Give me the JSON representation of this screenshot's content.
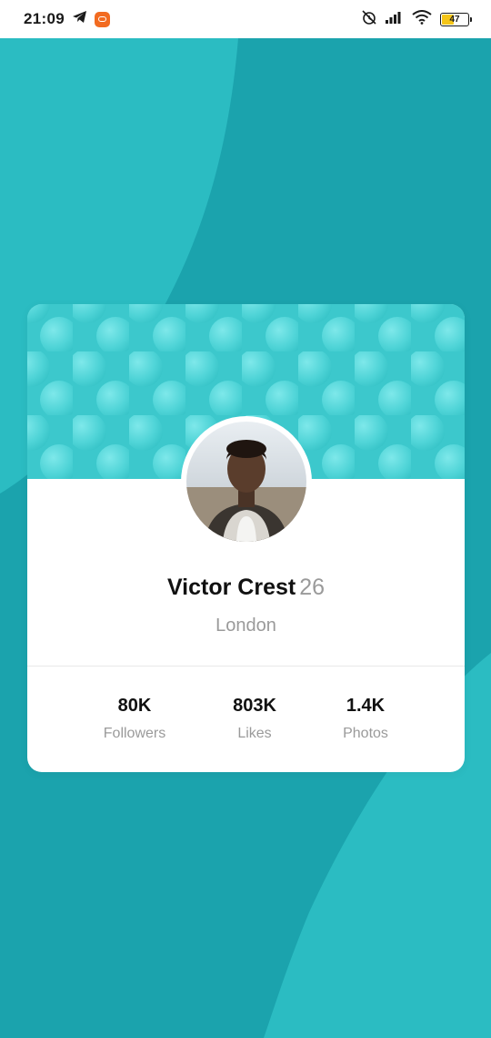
{
  "status_bar": {
    "time": "21:09",
    "battery_level": "47",
    "icons": [
      "telegram-icon",
      "app-notification-icon",
      "alarm-off-icon",
      "signal-icon",
      "wifi-icon",
      "battery-icon"
    ]
  },
  "colors": {
    "background": "#1ba3ad",
    "background_wave": "#2bbcc2",
    "header": "#3cc8cc",
    "card": "#ffffff",
    "muted_text": "#9a9a9a",
    "battery_fill": "#f5c518"
  },
  "profile": {
    "name": "Victor Crest",
    "age": "26",
    "city": "London"
  },
  "stats": [
    {
      "value": "80K",
      "label": "Followers"
    },
    {
      "value": "803K",
      "label": "Likes"
    },
    {
      "value": "1.4K",
      "label": "Photos"
    }
  ]
}
